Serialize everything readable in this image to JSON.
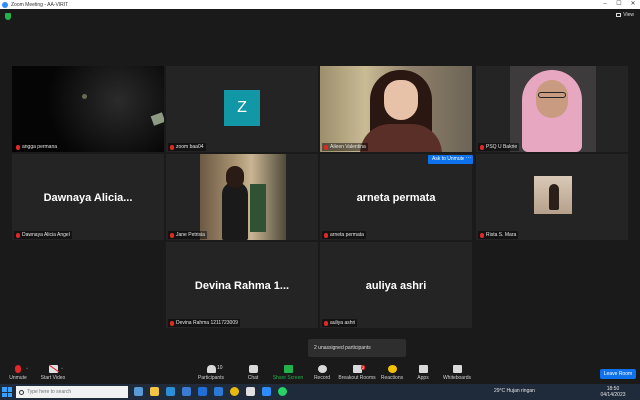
{
  "window": {
    "title": "Zoom Meeting - AA-VIRIT",
    "controls": [
      "–",
      "☐",
      "✕"
    ]
  },
  "header": {
    "view_label": "View"
  },
  "tiles": [
    {
      "name": "angga permana",
      "type": "video"
    },
    {
      "name": "zoom baa04",
      "type": "avatar",
      "avatar_letter": "Z"
    },
    {
      "name": "Aileen Valentina",
      "type": "video",
      "active": true
    },
    {
      "name": "PSQ U Bakrie",
      "type": "video"
    },
    {
      "name": "Dawnaya Alicia Angel",
      "type": "name",
      "display_name": "Dawnaya  Alicia..."
    },
    {
      "name": "Jane Petrisia",
      "type": "video"
    },
    {
      "name": "arneta permata",
      "type": "name",
      "display_name": "arneta permata"
    },
    {
      "name": "Rista S. Mara",
      "type": "video"
    },
    {
      "name": "Devina Rahma 1211723009",
      "type": "name",
      "display_name": "Devina  Rahma  1..."
    },
    {
      "name": "auliya ashri",
      "type": "name",
      "display_name": "auliya ashri"
    }
  ],
  "ask_to_unmute": "Ask to Unmute",
  "more_label": "···",
  "unassigned": "2 unassigned participants",
  "toolbar": {
    "unmute": "Unmute",
    "start_video": "Start Video",
    "participants": "Participants",
    "participants_count": "10",
    "chat": "Chat",
    "share_screen": "Share Screen",
    "record": "Record",
    "breakout_rooms": "Breakout Rooms",
    "breakout_badge": "2",
    "reactions": "Reactions",
    "apps": "Apps",
    "whiteboards": "Whiteboards",
    "leave": "Leave Room"
  },
  "taskbar": {
    "search_placeholder": "Type here to search",
    "weather": "29°C  Hujan ringan",
    "time": "18:50",
    "date": "04/14/2023"
  },
  "colors": {
    "accent": "#0e72ed",
    "active_border": "#c8e34a",
    "muted": "#e02828",
    "share": "#22b24c"
  }
}
